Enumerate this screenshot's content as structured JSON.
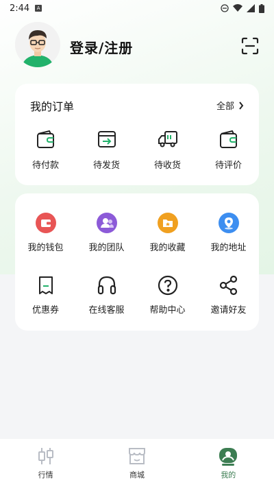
{
  "status_bar": {
    "time": "2:44",
    "app_badge": "A"
  },
  "header": {
    "login_label": "登录/注册"
  },
  "orders": {
    "title": "我的订单",
    "more_label": "全部",
    "items": [
      {
        "label": "待付款",
        "icon": "wallet-icon"
      },
      {
        "label": "待发货",
        "icon": "box-arrow-icon"
      },
      {
        "label": "待收货",
        "icon": "truck-icon"
      },
      {
        "label": "待评价",
        "icon": "review-wallet-icon"
      }
    ]
  },
  "tools": {
    "items": [
      {
        "label": "我的钱包",
        "icon": "wallet-circle-icon",
        "color": "#e85555"
      },
      {
        "label": "我的团队",
        "icon": "team-circle-icon",
        "color": "#8c5ad8"
      },
      {
        "label": "我的收藏",
        "icon": "folder-circle-icon",
        "color": "#f0a020"
      },
      {
        "label": "我的地址",
        "icon": "location-circle-icon",
        "color": "#3d8ef0"
      },
      {
        "label": "优惠券",
        "icon": "coupon-icon"
      },
      {
        "label": "在线客服",
        "icon": "headset-icon"
      },
      {
        "label": "帮助中心",
        "icon": "help-icon"
      },
      {
        "label": "邀请好友",
        "icon": "share-icon"
      }
    ]
  },
  "tabbar": {
    "items": [
      {
        "label": "行情",
        "icon": "candlestick-icon"
      },
      {
        "label": "商城",
        "icon": "store-icon"
      },
      {
        "label": "我的",
        "icon": "profile-icon",
        "active": true
      }
    ]
  },
  "colors": {
    "accent": "#3c7d52",
    "green": "#22b26b"
  }
}
